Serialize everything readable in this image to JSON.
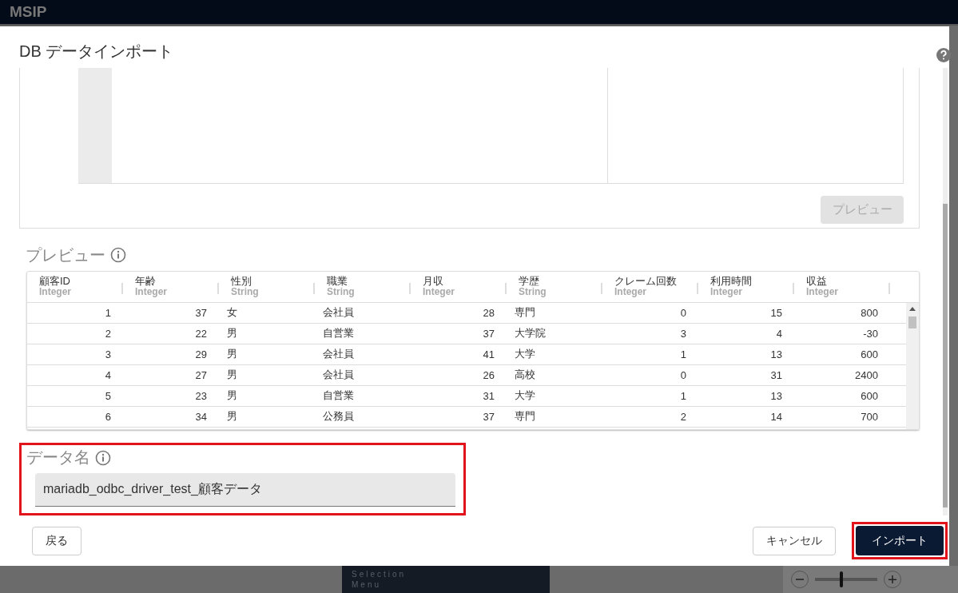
{
  "app": {
    "title": "MSIP"
  },
  "dialog": {
    "title": "DB データインポート",
    "source_panel": {
      "preview_button": {
        "label": "プレビュー",
        "disabled": true
      }
    },
    "preview": {
      "label": "プレビュー",
      "columns": [
        {
          "name": "顧客ID",
          "type": "Integer",
          "kind": "number"
        },
        {
          "name": "年齢",
          "type": "Integer",
          "kind": "number"
        },
        {
          "name": "性別",
          "type": "String",
          "kind": "text"
        },
        {
          "name": "職業",
          "type": "String",
          "kind": "text"
        },
        {
          "name": "月収",
          "type": "Integer",
          "kind": "number"
        },
        {
          "name": "学歴",
          "type": "String",
          "kind": "text"
        },
        {
          "name": "クレーム回数",
          "type": "Integer",
          "kind": "number"
        },
        {
          "name": "利用時間",
          "type": "Integer",
          "kind": "number"
        },
        {
          "name": "収益",
          "type": "Integer",
          "kind": "number"
        }
      ],
      "rows": [
        [
          "1",
          "37",
          "女",
          "会社員",
          "28",
          "専門",
          "0",
          "15",
          "800"
        ],
        [
          "2",
          "22",
          "男",
          "自営業",
          "37",
          "大学院",
          "3",
          "4",
          "-30"
        ],
        [
          "3",
          "29",
          "男",
          "会社員",
          "41",
          "大学",
          "1",
          "13",
          "600"
        ],
        [
          "4",
          "27",
          "男",
          "会社員",
          "26",
          "高校",
          "0",
          "31",
          "2400"
        ],
        [
          "5",
          "23",
          "男",
          "自営業",
          "31",
          "大学",
          "1",
          "13",
          "600"
        ],
        [
          "6",
          "34",
          "男",
          "公務員",
          "37",
          "専門",
          "2",
          "14",
          "700"
        ]
      ]
    },
    "data_name": {
      "label": "データ名",
      "value": "mariadb_odbc_driver_test_顧客データ",
      "highlighted": true
    },
    "buttons": [
      {
        "label": "戻る",
        "kind": "back",
        "highlighted": false
      },
      {
        "label": "キャンセル",
        "kind": "secondary",
        "highlighted": false
      },
      {
        "label": "インポート",
        "kind": "primary",
        "highlighted": true
      }
    ]
  },
  "background": {
    "selection_menu": {
      "label": "Selection Menu"
    },
    "zoom": {
      "level": 0.4
    }
  }
}
